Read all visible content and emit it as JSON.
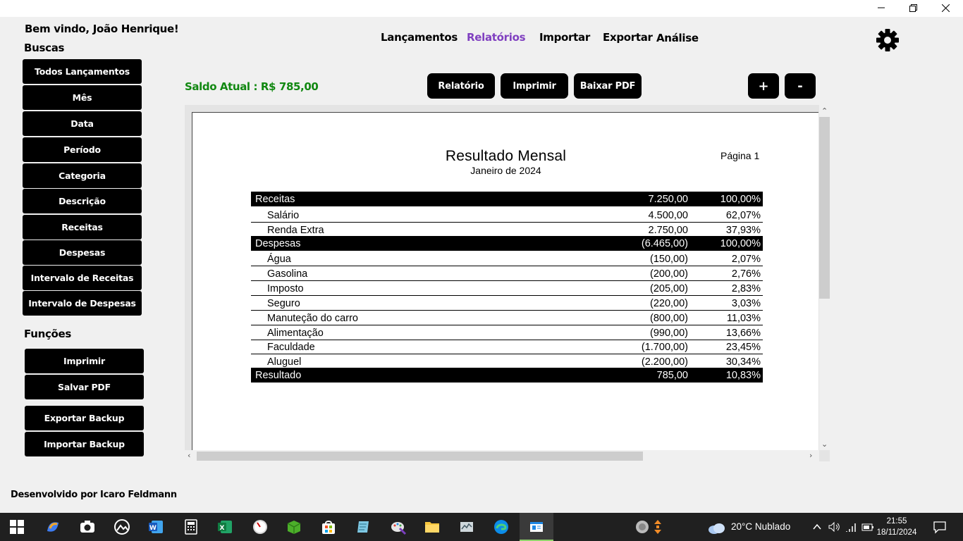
{
  "window": {
    "minimize_glyph": "—",
    "restore_glyph": "restore",
    "close_glyph": "close"
  },
  "welcome": "Bem vindo, João Henrique!",
  "sidebar": {
    "search_title": "Buscas",
    "search_items": [
      "Todos Lançamentos",
      "Mês",
      "Data",
      "Período",
      "Categoria",
      "Descrição",
      "Receitas",
      "Despesas",
      "Intervalo de Receitas",
      "Intervalo de Despesas"
    ],
    "functions_title": "Funções",
    "function_items": [
      "Imprimir",
      "Salvar PDF",
      "Exportar Backup",
      "Importar Backup"
    ]
  },
  "nav": {
    "items": [
      "Lançamentos",
      "Relatórios",
      "Importar",
      "Exportar",
      "Análise"
    ],
    "active": "Relatórios"
  },
  "saldo": "Saldo Atual : R$ 785,00",
  "toolbar": {
    "report_label": "Relatório",
    "print_label": "Imprimir",
    "pdf_label": "Baixar PDF",
    "zoom_in_label": "+",
    "zoom_out_label": "-"
  },
  "report": {
    "title": "Resultado Mensal",
    "subtitle": "Janeiro de 2024",
    "page": "Página 1",
    "rows": [
      {
        "type": "head",
        "label": "Receitas",
        "value": "7.250,00",
        "pct": "100,00%"
      },
      {
        "type": "item",
        "label": "Salário",
        "value": "4.500,00",
        "pct": "62,07%"
      },
      {
        "type": "item",
        "label": "Renda Extra",
        "value": "2.750,00",
        "pct": "37,93%"
      },
      {
        "type": "head",
        "label": "Despesas",
        "value": "(6.465,00)",
        "pct": "100,00%"
      },
      {
        "type": "item",
        "label": "Água",
        "value": "(150,00)",
        "pct": "2,07%"
      },
      {
        "type": "item",
        "label": "Gasolina",
        "value": "(200,00)",
        "pct": "2,76%"
      },
      {
        "type": "item",
        "label": "Imposto",
        "value": "(205,00)",
        "pct": "2,83%"
      },
      {
        "type": "item",
        "label": "Seguro",
        "value": "(220,00)",
        "pct": "3,03%"
      },
      {
        "type": "item",
        "label": "Manuteção do carro",
        "value": "(800,00)",
        "pct": "11,03%"
      },
      {
        "type": "item",
        "label": "Alimentação",
        "value": "(990,00)",
        "pct": "13,66%"
      },
      {
        "type": "item",
        "label": "Faculdade",
        "value": "(1.700,00)",
        "pct": "23,45%"
      },
      {
        "type": "item",
        "label": "Aluguel",
        "value": "(2.200,00)",
        "pct": "30,34%"
      },
      {
        "type": "head",
        "label": "Resultado",
        "value": "785,00",
        "pct": "10,83%"
      }
    ]
  },
  "footer": "Desenvolvido por Icaro Feldmann",
  "taskbar": {
    "weather": "20°C  Nublado",
    "time": "21:55",
    "date": "18/11/2024",
    "apps": [
      "start-icon",
      "copilot-icon",
      "camera-icon",
      "photos-icon",
      "word-icon",
      "calculator-icon",
      "excel-icon",
      "clock-app-icon",
      "minecraft-icon",
      "store-icon",
      "notepad-icon",
      "paint-icon",
      "file-explorer-icon",
      "perfmon-icon",
      "edge-icon",
      "active-app-icon"
    ]
  },
  "colors": {
    "accent_nav": "#8040c0",
    "saldo_green": "#118811",
    "button_bg": "#000000"
  }
}
